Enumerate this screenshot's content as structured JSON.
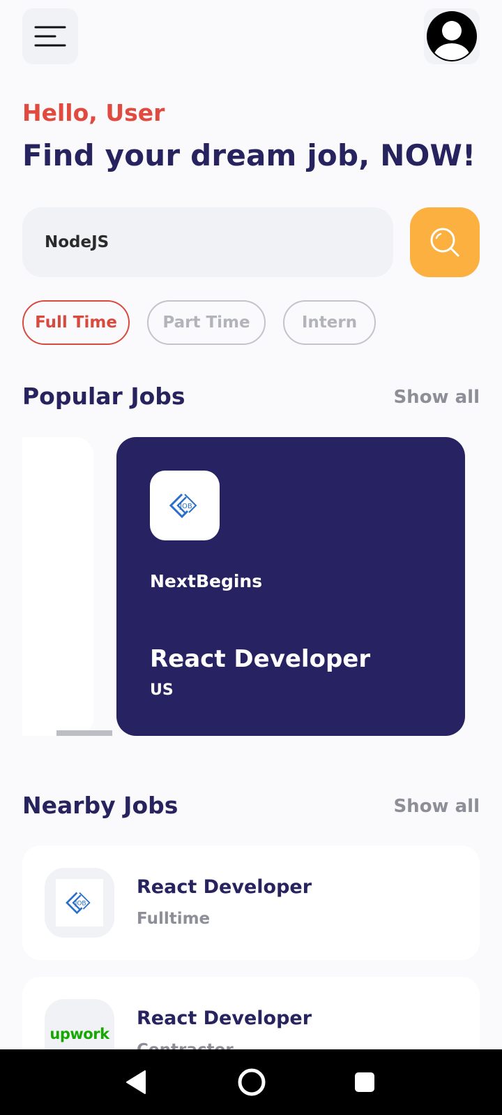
{
  "header": {
    "menu_icon": "hamburger-menu-icon",
    "avatar_icon": "user-avatar-icon"
  },
  "greeting": "Hello, User",
  "headline": "Find your dream job, NOW!",
  "search": {
    "value": "NodeJS",
    "button_icon": "search-icon",
    "button_color": "#FBB040"
  },
  "filters": [
    {
      "label": "Full Time",
      "active": true
    },
    {
      "label": "Part Time",
      "active": false
    },
    {
      "label": "Intern",
      "active": false
    }
  ],
  "popular": {
    "title": "Popular Jobs",
    "show_all": "Show all",
    "card": {
      "logo_icon": "job-logo-icon",
      "company": "NextBegins",
      "job_title": "React Developer",
      "location": "US",
      "background": "#272262"
    }
  },
  "nearby": {
    "title": "Nearby Jobs",
    "show_all": "Show all",
    "items": [
      {
        "logo_icon": "job-logo-icon",
        "job_title": "React Developer",
        "type": "Fulltime"
      },
      {
        "logo_text": "upwork",
        "job_title": "React Developer",
        "type": "Contractor"
      }
    ]
  },
  "colors": {
    "accent_red": "#E04A3F",
    "navy": "#26235F",
    "muted": "#8D8E98",
    "upwork_green": "#14A800"
  },
  "system_nav": {
    "back_icon": "back-triangle-icon",
    "home_icon": "home-circle-icon",
    "recents_icon": "recents-square-icon"
  }
}
